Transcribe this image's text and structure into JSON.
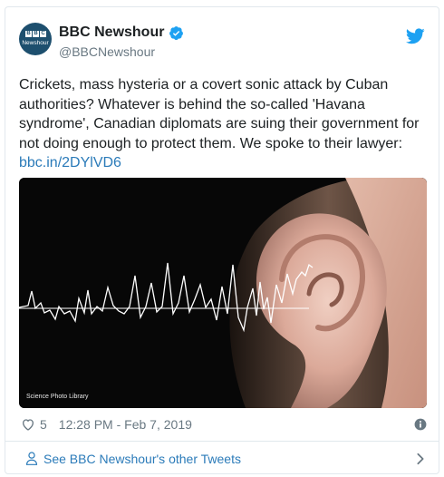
{
  "tweet": {
    "author_name": "BBC Newshour",
    "handle": "@BBCNewshour",
    "avatar": {
      "letters": [
        "B",
        "B",
        "C"
      ],
      "sub": "Newshour"
    },
    "text": "Crickets, mass hysteria or a covert sonic attack by Cuban authorities? Whatever is behind the so-called 'Havana syndrome', Canadian diplomats are suing their government for not doing enough to protect them. We spoke to their lawyer: ",
    "link": "bbc.in/2DYlVD6",
    "media_credit": "Science Photo Library",
    "likes": "5",
    "timestamp": "12:28 PM - Feb 7, 2019",
    "footer_label": "See BBC Newshour's other Tweets"
  },
  "icons": {
    "verified": "verified-badge-icon",
    "platform": "twitter-bird-icon",
    "like": "heart-icon",
    "info": "info-icon",
    "profile": "person-icon",
    "more": "chevron-right-icon"
  },
  "colors": {
    "link": "#2b7bb9",
    "verified": "#1da1f2",
    "muted": "#697882",
    "border": "#e1e8ed",
    "avatar_bg": "#1d4f6e"
  }
}
